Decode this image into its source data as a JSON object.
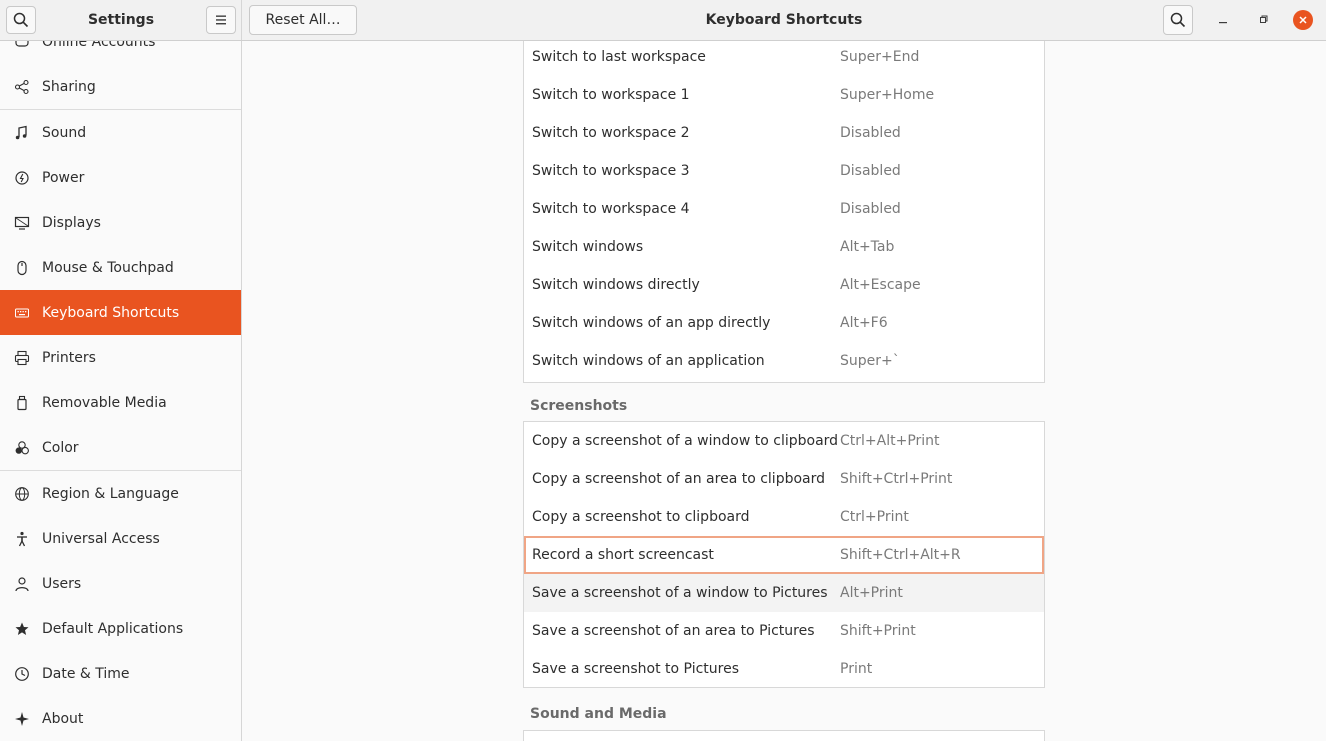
{
  "header": {
    "sidebar_title": "Settings",
    "reset_label": "Reset All…",
    "title": "Keyboard Shortcuts",
    "accent": "#e95420"
  },
  "sidebar": {
    "items": [
      {
        "label": "Online Accounts",
        "icon": "online-accounts-icon"
      },
      {
        "label": "Sharing",
        "icon": "share-icon"
      },
      {
        "label": "Sound",
        "icon": "music-note-icon"
      },
      {
        "label": "Power",
        "icon": "power-icon"
      },
      {
        "label": "Displays",
        "icon": "display-icon"
      },
      {
        "label": "Mouse & Touchpad",
        "icon": "mouse-icon"
      },
      {
        "label": "Keyboard Shortcuts",
        "icon": "keyboard-icon",
        "active": true
      },
      {
        "label": "Printers",
        "icon": "printer-icon"
      },
      {
        "label": "Removable Media",
        "icon": "removable-media-icon"
      },
      {
        "label": "Color",
        "icon": "color-icon"
      },
      {
        "label": "Region & Language",
        "icon": "globe-icon"
      },
      {
        "label": "Universal Access",
        "icon": "accessibility-icon"
      },
      {
        "label": "Users",
        "icon": "user-icon"
      },
      {
        "label": "Default Applications",
        "icon": "star-icon"
      },
      {
        "label": "Date & Time",
        "icon": "clock-icon"
      },
      {
        "label": "About",
        "icon": "sparkle-icon"
      }
    ]
  },
  "navigation_rows": [
    {
      "name": "Switch to last workspace",
      "accel": "Super+End"
    },
    {
      "name": "Switch to workspace 1",
      "accel": "Super+Home"
    },
    {
      "name": "Switch to workspace 2",
      "accel": "Disabled"
    },
    {
      "name": "Switch to workspace 3",
      "accel": "Disabled"
    },
    {
      "name": "Switch to workspace 4",
      "accel": "Disabled"
    },
    {
      "name": "Switch windows",
      "accel": "Alt+Tab"
    },
    {
      "name": "Switch windows directly",
      "accel": "Alt+Escape"
    },
    {
      "name": "Switch windows of an app directly",
      "accel": "Alt+F6"
    },
    {
      "name": "Switch windows of an application",
      "accel": "Super+`"
    }
  ],
  "screenshots": {
    "title": "Screenshots",
    "rows": [
      {
        "name": "Copy a screenshot of a window to clipboard",
        "accel": "Ctrl+Alt+Print"
      },
      {
        "name": "Copy a screenshot of an area to clipboard",
        "accel": "Shift+Ctrl+Print"
      },
      {
        "name": "Copy a screenshot to clipboard",
        "accel": "Ctrl+Print"
      },
      {
        "name": "Record a short screencast",
        "accel": "Shift+Ctrl+Alt+R"
      },
      {
        "name": "Save a screenshot of a window to Pictures",
        "accel": "Alt+Print"
      },
      {
        "name": "Save a screenshot of an area to Pictures",
        "accel": "Shift+Print"
      },
      {
        "name": "Save a screenshot to Pictures",
        "accel": "Print"
      }
    ]
  },
  "sound_media": {
    "title": "Sound and Media"
  }
}
